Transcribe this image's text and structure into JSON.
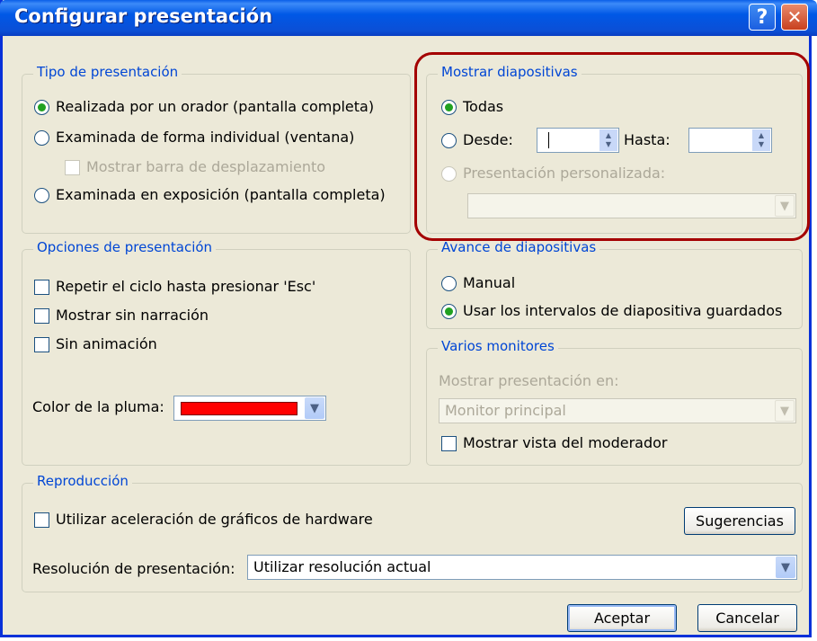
{
  "window": {
    "title": "Configurar presentación",
    "help_glyph": "?",
    "close_glyph": "✕"
  },
  "tipo": {
    "legend": "Tipo de presentación",
    "opt1": "Realizada por un orador (pantalla completa)",
    "opt2": "Examinada de forma individual (ventana)",
    "opt2_sub": "Mostrar barra de desplazamiento",
    "opt3": "Examinada en exposición (pantalla completa)"
  },
  "mostrar": {
    "legend": "Mostrar diapositivas",
    "todas": "Todas",
    "desde": "Desde:",
    "hasta": "Hasta:",
    "personalizada": "Presentación personalizada:"
  },
  "opciones": {
    "legend": "Opciones de presentación",
    "repetir": "Repetir el ciclo hasta presionar 'Esc'",
    "narracion": "Mostrar sin narración",
    "animacion": "Sin animación",
    "pluma_label": "Color de la pluma:",
    "pluma_color": "#ff0000"
  },
  "avance": {
    "legend": "Avance de diapositivas",
    "manual": "Manual",
    "intervalos": "Usar los intervalos de diapositiva guardados"
  },
  "monitores": {
    "legend": "Varios monitores",
    "mostrar_en": "Mostrar presentación en:",
    "monitor_value": "Monitor principal",
    "moderador": "Mostrar vista del moderador"
  },
  "reproduccion": {
    "legend": "Reproducción",
    "aceleracion": "Utilizar aceleración de gráficos de hardware",
    "sugerencias": "Sugerencias",
    "resolucion_label": "Resolución de presentación:",
    "resolucion_value": "Utilizar resolución actual"
  },
  "buttons": {
    "aceptar": "Aceptar",
    "cancelar": "Cancelar"
  },
  "icons": {
    "dropdown": "chevron-down-icon",
    "spinner": "spin-arrows-icon"
  }
}
